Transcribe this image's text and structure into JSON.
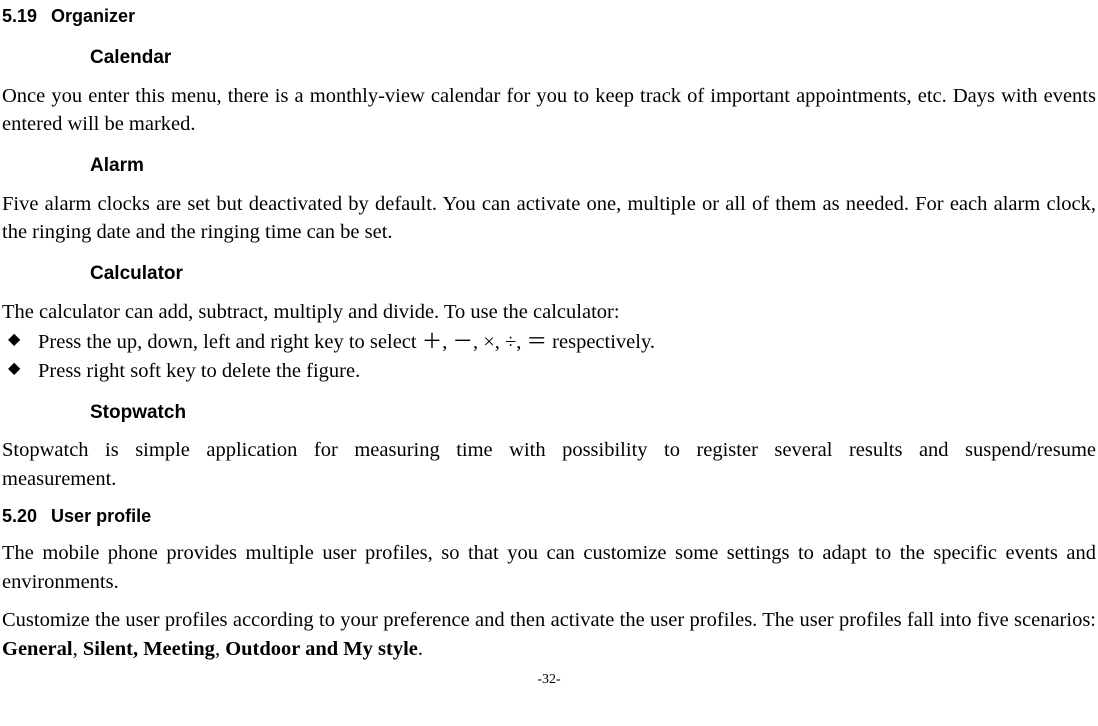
{
  "section519": {
    "num": "5.19",
    "title": "Organizer",
    "calendar": {
      "heading": "Calendar",
      "para": "Once you enter this menu, there is a monthly-view calendar for you to keep track of important appointments, etc. Days with events entered will be marked."
    },
    "alarm": {
      "heading": "Alarm",
      "para": "Five alarm clocks are set but deactivated by default. You can activate one, multiple or all of them as needed. For each alarm clock, the ringing date and the ringing time can be set."
    },
    "calculator": {
      "heading": "Calculator",
      "intro": "The calculator can add, subtract, multiply and divide. To use the calculator:",
      "bullet1": "Press the up, down, left and right key to select ＋, －, ×, ÷, ＝ respectively.",
      "bullet2": "Press right soft key to delete the figure."
    },
    "stopwatch": {
      "heading": "Stopwatch",
      "para": "Stopwatch is simple application for measuring time with possibility to register several results and suspend/resume measurement."
    }
  },
  "section520": {
    "num": "5.20",
    "title": "User profile",
    "para1": "The mobile phone provides multiple user profiles, so that you can customize some settings to adapt to the specific events and environments.",
    "para2_pre": "Customize the user profiles according to your preference and then activate the user profiles. The user profiles fall into five scenarios: ",
    "bold1": "General",
    "sep1": ", ",
    "bold2": "Silent, Meeting",
    "sep2": ", ",
    "bold3": "Outdoor and My style",
    "sep3": "."
  },
  "footer": "-32-"
}
